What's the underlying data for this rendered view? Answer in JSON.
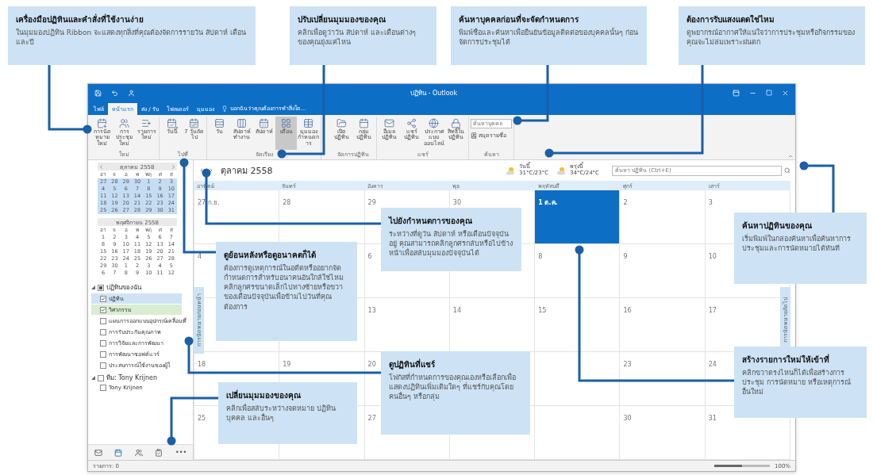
{
  "window": {
    "title": "ปฏิทิน - Outlook"
  },
  "tabs": [
    {
      "label": "ไฟล์",
      "selected": false
    },
    {
      "label": "หน้าแรก",
      "selected": true
    },
    {
      "label": "ส่ง / รับ",
      "selected": false
    },
    {
      "label": "โฟลเดอร์",
      "selected": false
    },
    {
      "label": "มุมมอง",
      "selected": false
    }
  ],
  "tell_me": "บอกฉันว่าคุณต้องการทำสิ่งใด...",
  "ribbon": [
    {
      "label": "ใหม่",
      "buttons": [
        {
          "label": "การนัดหมายใหม่",
          "selected": false
        },
        {
          "label": "การประชุมใหม่",
          "selected": false
        },
        {
          "label": "รายการใหม่",
          "selected": false
        }
      ]
    },
    {
      "label": "ไปที่",
      "buttons": [
        {
          "label": "วันนี้",
          "selected": false
        },
        {
          "label": "7 วันถัดไป",
          "selected": false
        }
      ]
    },
    {
      "label": "จัดเรียง",
      "buttons": [
        {
          "label": "วัน",
          "selected": false
        },
        {
          "label": "สัปดาห์ทำงาน",
          "selected": false
        },
        {
          "label": "สัปดาห์",
          "selected": false
        },
        {
          "label": "เดือน",
          "selected": true
        },
        {
          "label": "มุมมองกำหนดการ",
          "selected": false
        }
      ]
    },
    {
      "label": "จัดการปฏิทิน",
      "buttons": [
        {
          "label": "เปิดปฏิทิน",
          "selected": false
        },
        {
          "label": "กลุ่มปฏิทิน",
          "selected": false
        }
      ]
    },
    {
      "label": "แชร์",
      "buttons": [
        {
          "label": "อีเมลปฏิทิน",
          "selected": false
        },
        {
          "label": "แชร์ปฏิทิน",
          "selected": false
        },
        {
          "label": "ประกาศแบบออนไลน์",
          "selected": false
        },
        {
          "label": "สิทธิ์ในปฏิทิน",
          "selected": false
        }
      ]
    }
  ],
  "find": {
    "label": "ค้นหา",
    "placeholder": "ค้นหาบุคคล",
    "address_book": "สมุดรายชื่อ"
  },
  "mini_calendars": [
    {
      "title": "ตุลาคม 2558",
      "selected": true,
      "weekdays": [
        "อา",
        "จ",
        "อ",
        "พ",
        "พฤ",
        "ศ",
        "ส"
      ],
      "days": [
        "27",
        "28",
        "29",
        "30",
        "1",
        "2",
        "3",
        "4",
        "5",
        "6",
        "7",
        "8",
        "9",
        "10",
        "11",
        "12",
        "13",
        "14",
        "15",
        "16",
        "17",
        "18",
        "19",
        "20",
        "21",
        "22",
        "23",
        "24",
        "25",
        "26",
        "27",
        "28",
        "29",
        "30",
        "31"
      ]
    },
    {
      "title": "พฤศจิกายน 2558",
      "selected": false,
      "weekdays": [
        "อา",
        "จ",
        "อ",
        "พ",
        "พฤ",
        "ศ",
        "ส"
      ],
      "days": [
        "1",
        "2",
        "3",
        "4",
        "5",
        "6",
        "7",
        "8",
        "9",
        "10",
        "11",
        "12",
        "13",
        "14",
        "15",
        "16",
        "17",
        "18",
        "19",
        "20",
        "21",
        "22",
        "23",
        "24",
        "25",
        "26",
        "27",
        "28",
        "29",
        "30",
        "1",
        "2",
        "3",
        "4",
        "5",
        "6",
        "7",
        "8",
        "9",
        "10",
        "11",
        "12"
      ]
    }
  ],
  "folders": [
    {
      "label": "ปฏิทินของฉัน",
      "checked": true,
      "expanded": true,
      "children": [
        {
          "label": "ปฏิทิน",
          "checked": true,
          "color": "#cfe3f5"
        },
        {
          "label": "วิศวกรรม",
          "checked": true,
          "color": "#d9edd2"
        },
        {
          "label": "แผนการออกแบบอุปกรณ์เคลื่อนที่",
          "checked": false
        },
        {
          "label": "การรับประกันคุณภาพ",
          "checked": false
        },
        {
          "label": "การวิจัยและการพัฒนา",
          "checked": false
        },
        {
          "label": "การพัฒนาซอฟต์แวร์",
          "checked": false
        },
        {
          "label": "ประสบการณ์ใช้งานของผู้ใ",
          "checked": false
        }
      ]
    },
    {
      "label": "ทีม: Tony Krijnen",
      "checked": false,
      "expanded": true,
      "children": [
        {
          "label": "Tony Krijnen",
          "checked": false
        }
      ]
    }
  ],
  "nav": [
    {
      "kind": "mail",
      "selected": false
    },
    {
      "kind": "calendar",
      "selected": true
    },
    {
      "kind": "people",
      "selected": false
    },
    {
      "kind": "tasks",
      "selected": false
    },
    {
      "kind": "more",
      "label": "•••",
      "selected": false
    }
  ],
  "month_title": "ตุลาคม 2558",
  "weather": [
    {
      "day": "วันนี้",
      "temps": "31°C/23°C"
    },
    {
      "day": "พรุ่งนี้",
      "temps": "34°C/24°C"
    }
  ],
  "calendar_search": {
    "placeholder": "ค้นหา ปฏิทิน (Ctrl+E)"
  },
  "weekdays": [
    "อาทิตย์",
    "จันทร์",
    "อังคาร",
    "พุธ",
    "พฤหัสบดี",
    "ศุกร์",
    "เสาร์"
  ],
  "days": [
    {
      "label": "27 ก.ย.",
      "selected": false
    },
    {
      "label": "28",
      "selected": false
    },
    {
      "label": "29",
      "selected": false
    },
    {
      "label": "30",
      "selected": false
    },
    {
      "label": "1 ต.ค.",
      "selected": true
    },
    {
      "label": "2",
      "selected": false
    },
    {
      "label": "3",
      "selected": false
    },
    {
      "label": "4",
      "selected": false
    },
    {
      "selected": false
    },
    {
      "label": "6",
      "selected": false
    },
    {
      "selected": false
    },
    {
      "label": "8",
      "selected": false
    },
    {
      "label": "9",
      "selected": false
    },
    {
      "label": "10",
      "selected": false
    },
    {
      "selected": false
    },
    {
      "selected": false
    },
    {
      "label": "13",
      "selected": false
    },
    {
      "label": "14",
      "selected": false
    },
    {
      "label": "15",
      "selected": false
    },
    {
      "label": "16",
      "selected": false
    },
    {
      "label": "17",
      "selected": false
    },
    {
      "label": "18",
      "selected": false
    },
    {
      "label": "19",
      "selected": false
    },
    {
      "label": "20",
      "selected": false
    },
    {
      "selected": false
    },
    {
      "selected": false
    },
    {
      "label": "23",
      "selected": false
    },
    {
      "label": "24",
      "selected": false
    },
    {
      "label": "25",
      "selected": false
    },
    {
      "selected": false
    },
    {
      "label": "27",
      "selected": false
    },
    {
      "selected": false
    },
    {
      "selected": false
    },
    {
      "label": "30",
      "selected": false
    },
    {
      "label": "31",
      "selected": false
    }
  ],
  "side_tabs": [
    "การนัดหมายก่อนหน้า",
    "การนัดหมายถัดไป"
  ],
  "status_bar": {
    "items": "รายการ: 0",
    "zoom": {
      "level": 0.5,
      "reading": "100%"
    }
  },
  "callouts": [
    {
      "title": "เครื่องมือปฏิทินและคำสั่งที่ใช้งานง่าย",
      "body": "ในมุมมองปฏิทิน Ribbon จะแสดงทุกสิ่งที่คุณต้องจัดการรายวัน สัปดาห์ เดือน และปี"
    },
    {
      "title": "ปรับเปลี่ยนมุมมองของคุณ",
      "body": "คลิกเพื่อดูว่าวัน สัปดาห์ และเดือนต่างๆ ของคุณยุ่งแค่ไหน"
    },
    {
      "title": "ค้นหาบุคคลก่อนที่จะจัดกำหนดการ",
      "body": "พิมพ์ชื่อและค้นหาเพื่อยืนยันข้อมูลติดต่อของบุคคลนั้นๆ ก่อนจัดการประชุมได้"
    },
    {
      "title": "ต้องการรับแสงแดดใช่ไหม",
      "body": "ดูพยากรณ์อากาศให้แน่ใจว่าการประชุมหรือกิจกรรมของคุณจะไม่ล่มเพราะฝนตก"
    },
    {
      "title": "ไปยังกำหนดการของคุณ",
      "body": "ระหว่างที่ดูวัน สัปดาห์ หรือเดือนปัจจุบันอยู่ คุณสามารถคลิกลูกศรกลับหรือไปข้างหน้าเพื่อสลับมุมมองปัจจุบันได้"
    },
    {
      "title": "ค้นหาปฏิทินของคุณ",
      "body": "เริ่มพิมพ์ในกล่องค้นหาเพื่อค้นหาการประชุมและการนัดหมายได้ทันที"
    },
    {
      "title": "ดูย้อนหลังหรือดูอนาคตก็ได้",
      "body": "ต้องการดูเหตุการณ์ในอดีตหรืออยากจัดกำหนดการสำหรับอนาคนอันใกล้ใช่ไหม คลิกลูกศรขนาดเล็กไปทางซ้ายหรือขวาของเดือนปัจจุบันเพื่อข้ามไปวันที่คุณต้องการ"
    },
    {
      "title": "สร้างรายการใหม่ให้เข้าที่",
      "body": "คลิกขวาตรงไหนก็ได้เพื่อสร้างการประชุม การนัดหมาย หรือเหตุการณ์อื่นใหม่"
    },
    {
      "title": "ดูปฏิทินที่แชร์",
      "body": "โฟกัสที่กำหนดการของคุณเองหรือเลือกเพื่อแสดงปฏิทินเพิ่มเติมใดๆ ที่แชร์กับคุณโดยคนอื่นๆ หรือกลุ่ม"
    },
    {
      "title": "เปลี่ยนมุมมองของคุณ",
      "body": "คลิกเพื่อสลับระหว่างจดหมาย ปฏิทิน บุคคล และอื่นๆ"
    }
  ]
}
